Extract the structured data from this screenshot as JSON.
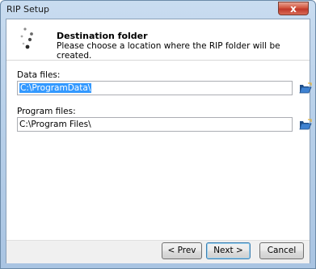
{
  "window": {
    "title": "RIP Setup",
    "close_label": "x"
  },
  "header": {
    "title": "Destination folder",
    "subtitle": "Please choose a location where the RIP folder will be created.",
    "icon": "spinner-dots-icon"
  },
  "fields": {
    "data_files": {
      "label": "Data files:",
      "value": "C:\\ProgramData\\",
      "selected": true,
      "browse_icon": "folder-open-icon"
    },
    "program_files": {
      "label": "Program files:",
      "value": "C:\\Program Files\\",
      "selected": false,
      "browse_icon": "folder-open-icon"
    }
  },
  "footer": {
    "prev_label": "< Prev",
    "next_label": "Next >",
    "cancel_label": "Cancel"
  },
  "colors": {
    "selection": "#3399ff",
    "close_button": "#c0392b",
    "folder": "#2b6cb0"
  }
}
